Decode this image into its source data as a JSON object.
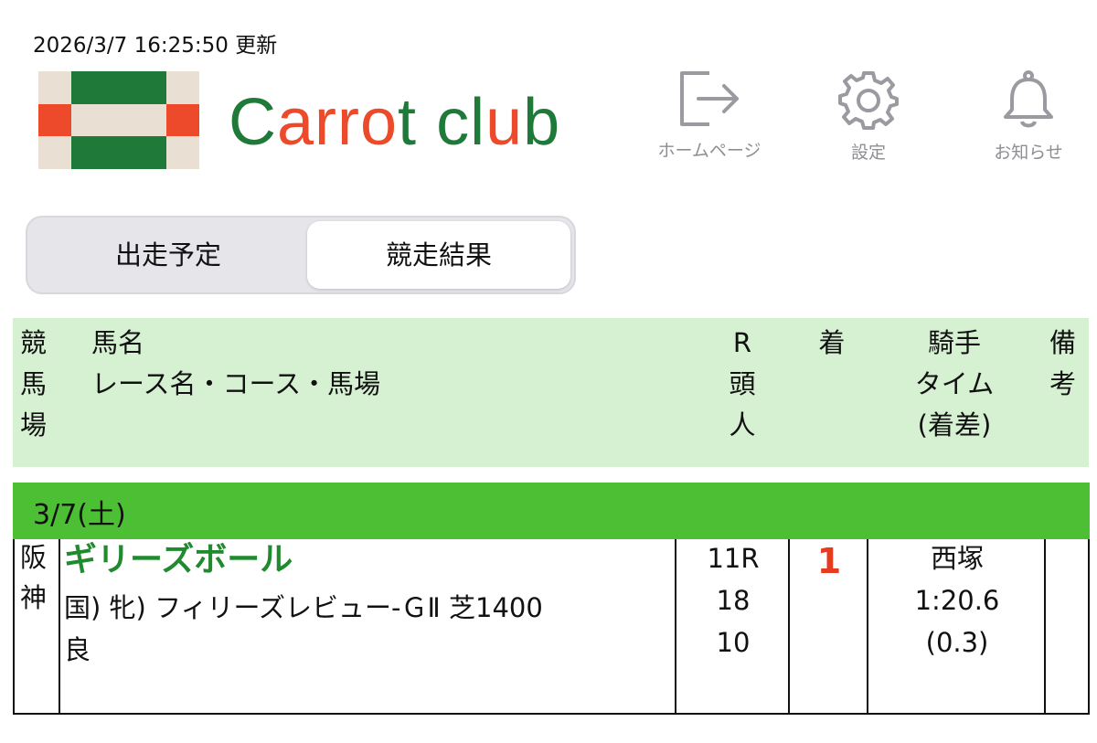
{
  "updated": "2026/3/7 16:25:50 更新",
  "brand": {
    "c": "C",
    "arro": "arro",
    "t": "t",
    "cl": "cl",
    "u": "u",
    "b": "b"
  },
  "header_buttons": {
    "home": "ホームページ",
    "settings": "設定",
    "notice": "お知らせ"
  },
  "tabs": {
    "scheduled": "出走予定",
    "results": "競走結果",
    "selected": "results"
  },
  "table_header": {
    "venue": [
      "競",
      "馬",
      "場"
    ],
    "name_line1": "馬名",
    "name_line2": "レース名・コース・馬場",
    "r_col": [
      "R",
      "頭",
      "人"
    ],
    "finish": "着",
    "jockey_col": [
      "騎手",
      "タイム",
      "(着差)"
    ],
    "note": [
      "備",
      "考"
    ]
  },
  "date": "3/7(土)",
  "rows": [
    {
      "venue": [
        "阪",
        "神"
      ],
      "horse": "ギリーズボール",
      "race_line1": "国) 牝) フィリーズレビュー-ＧⅡ 芝1400",
      "race_line2": "良",
      "race_no": "11R",
      "runners": "18",
      "popularity": "10",
      "finish": "1",
      "jockey": "西塚",
      "time": "1:20.6",
      "margin": "(0.3)",
      "note": ""
    }
  ],
  "colors": {
    "brand_green": "#1f7a3a",
    "brand_orange": "#ec4a2a",
    "header_bg": "#d6f0d2",
    "date_band": "#4cbf34",
    "finish_red": "#e63b1f"
  }
}
